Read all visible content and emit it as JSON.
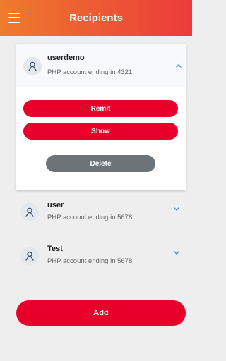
{
  "header": {
    "title": "Recipients",
    "menu_icon": "hamburger-menu-icon"
  },
  "recipients": [
    {
      "name": "userdemo",
      "detail": "PHP account ending in 4321",
      "expanded": true,
      "actions": {
        "remit": "Remit",
        "show": "Show",
        "delete": "Delete"
      }
    },
    {
      "name": "user",
      "detail": "PHP account ending in 5678",
      "expanded": false
    },
    {
      "name": "Test",
      "detail": "PHP account ending in 5678",
      "expanded": false
    }
  ],
  "footer": {
    "add_label": "Add"
  },
  "colors": {
    "header_start": "#ee7b2c",
    "header_end": "#ec3b3b",
    "primary_red": "#e8002a",
    "delete_gray": "#6d7377",
    "chevron_blue": "#3d8fd6"
  }
}
